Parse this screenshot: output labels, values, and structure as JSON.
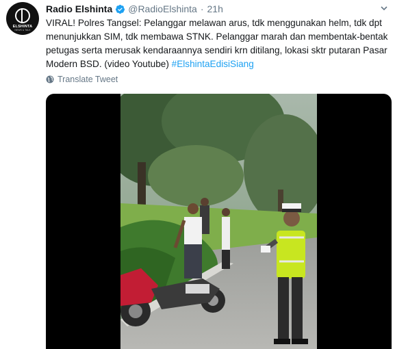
{
  "tweet": {
    "author_name": "Radio Elshinta",
    "handle": "@RadioElshinta",
    "separator": "·",
    "time": "21h",
    "text_before": "VIRAL! Polres Tangsel: Pelanggar melawan arus, tdk menggunakan helm, tdk dpt menunjukkan SIM, tdk membawa STNK. Pelanggar marah dan membentak-bentak petugas serta merusak kendaraannya sendiri krn ditilang, lokasi sktr putaran Pasar Modern BSD. (video Youtube)",
    "hashtag": "#ElshintaEdisiSiang",
    "translate_label": "Translate Tweet",
    "avatar_logo_text": "ELSHINTA",
    "avatar_logo_sub": "NEWS & TALK"
  },
  "colors": {
    "accent": "#1da1f2",
    "muted": "#657786",
    "text": "#14171a",
    "media_background": "#000000",
    "officer_vest": "#c8e620"
  },
  "icons": {
    "verified": "verified-badge-icon",
    "caret": "chevron-down-icon",
    "translate": "globe-icon"
  }
}
